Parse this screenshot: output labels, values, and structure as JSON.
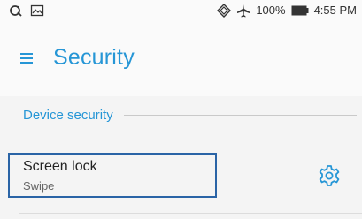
{
  "status_bar": {
    "battery": "100%",
    "time": "4:55 PM"
  },
  "app_bar": {
    "title": "Security",
    "menu_icon": "hamburger-menu-icon"
  },
  "sections": [
    {
      "title": "Device security",
      "items": [
        {
          "title": "Screen lock",
          "subtitle": "Swipe",
          "action_icon": "gear-icon"
        }
      ]
    }
  ],
  "colors": {
    "accent": "#2696d6",
    "focus_border": "#2a64a6",
    "background": "#f4f4f4"
  }
}
